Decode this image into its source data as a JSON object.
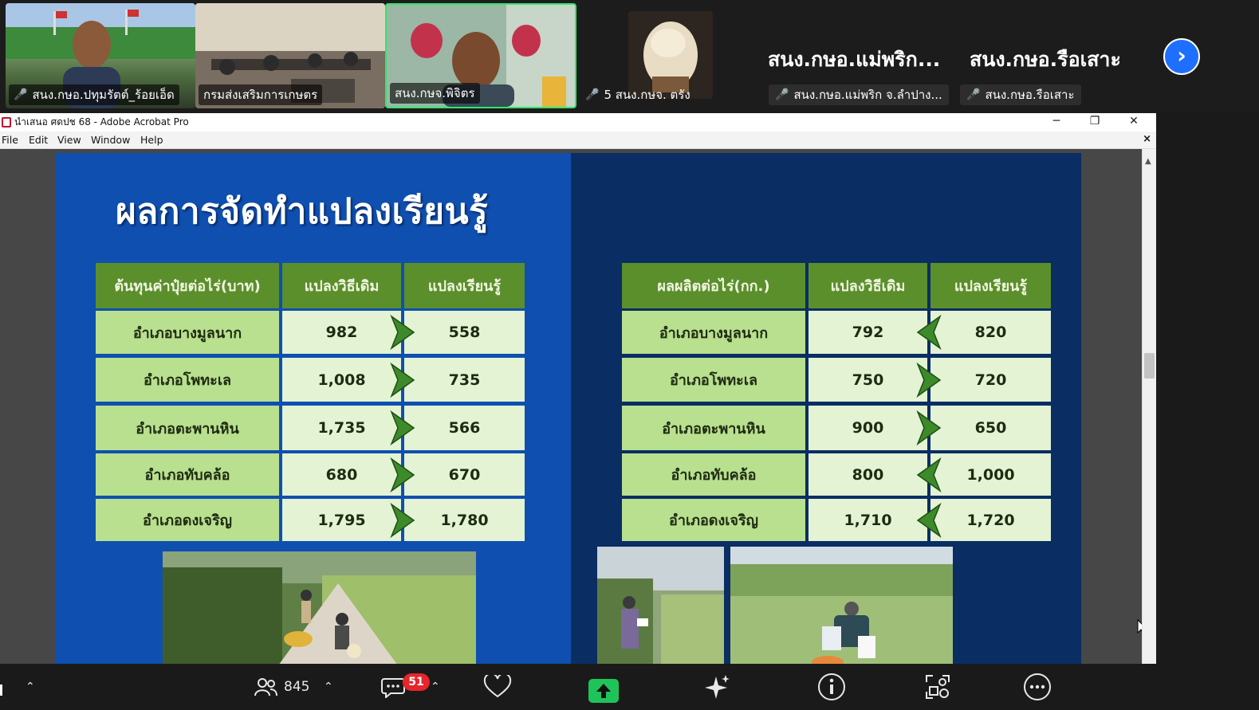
{
  "participants": [
    {
      "name": "สนง.กษอ.ปทุมรัตต์_ร้อยเอ็ด",
      "muted": true
    },
    {
      "name": "กรมส่งเสริมการเกษตร",
      "muted": false
    },
    {
      "name": "สนง.กษจ.พิจิตร",
      "muted": false,
      "active": true
    },
    {
      "name": "5 สนง.กษจ. ตรัง",
      "muted": true
    },
    {
      "name": "สนง.กษอ.แม่พริก จ.ลำปาง...",
      "display": "สนง.กษอ.แม่พริก...",
      "muted": true
    },
    {
      "name": "สนง.กษอ.รือเสาะ",
      "display": "สนง.กษอ.รือเสาะ",
      "muted": true
    }
  ],
  "window": {
    "title": "นำเสนอ ศดปช 68 - Adobe Acrobat Pro",
    "controls": {
      "minimize": "─",
      "restore": "❐",
      "close": "✕"
    },
    "menu": [
      "File",
      "Edit",
      "View",
      "Window",
      "Help"
    ],
    "menu_close": "×"
  },
  "slide": {
    "title": "ผลการจัดทำแปลงเรียนรู้",
    "left_table": {
      "headers": [
        "ต้นทุนค่าปุ๋ยต่อไร่(บาท)",
        "แปลงวิธีเดิม",
        "แปลงเรียนรู้"
      ],
      "rows": [
        {
          "label": "อำเภอบางมูลนาก",
          "old": "982",
          "new": "558",
          "arrow": ">"
        },
        {
          "label": "อำเภอโพทะเล",
          "old": "1,008",
          "new": "735",
          "arrow": ">"
        },
        {
          "label": "อำเภอตะพานหิน",
          "old": "1,735",
          "new": "566",
          "arrow": ">"
        },
        {
          "label": "อำเภอทับคล้อ",
          "old": "680",
          "new": "670",
          "arrow": ">"
        },
        {
          "label": "อำเภอดงเจริญ",
          "old": "1,795",
          "new": "1,780",
          "arrow": ">"
        }
      ]
    },
    "right_table": {
      "headers": [
        "ผลผลิตต่อไร่(กก.)",
        "แปลงวิธีเดิม",
        "แปลงเรียนรู้"
      ],
      "rows": [
        {
          "label": "อำเภอบางมูลนาก",
          "old": "792",
          "new": "820",
          "arrow": "<"
        },
        {
          "label": "อำเภอโพทะเล",
          "old": "750",
          "new": "720",
          "arrow": ">"
        },
        {
          "label": "อำเภอตะพานหิน",
          "old": "900",
          "new": "650",
          "arrow": ">"
        },
        {
          "label": "อำเภอทับคล้อ",
          "old": "800",
          "new": "1,000",
          "arrow": "<"
        },
        {
          "label": "อำเภอดงเจริญ",
          "old": "1,710",
          "new": "1,720",
          "arrow": "<"
        }
      ]
    }
  },
  "toolbar": {
    "participants_count": "845",
    "chat_badge": "51"
  },
  "colors": {
    "accent_green": "#2ee86d",
    "mute_red": "#e5484d",
    "header_green": "#5a8f2c",
    "label_green": "#b8e08e",
    "value_green": "#e3f3d3"
  }
}
